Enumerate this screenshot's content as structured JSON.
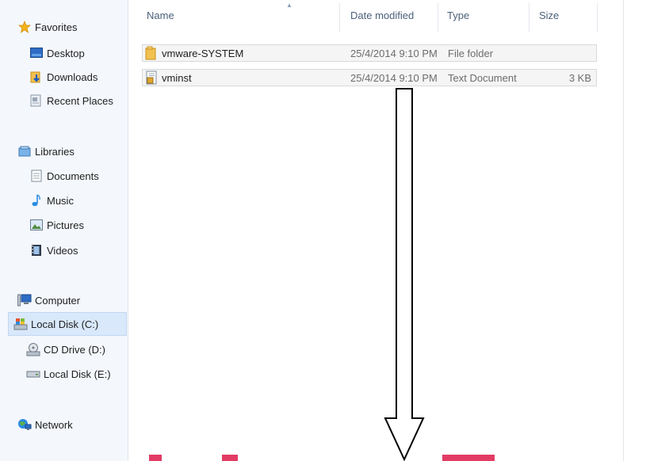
{
  "nav": {
    "favorites": "Favorites",
    "desktop": "Desktop",
    "downloads": "Downloads",
    "recent_places": "Recent Places",
    "libraries": "Libraries",
    "documents": "Documents",
    "music": "Music",
    "pictures": "Pictures",
    "videos": "Videos",
    "computer": "Computer",
    "local_disk_c": "Local Disk (C:)",
    "cd_drive_d": "CD Drive (D:)",
    "local_disk_e": "Local Disk (E:)",
    "network": "Network"
  },
  "columns": {
    "name": "Name",
    "date_modified": "Date modified",
    "type": "Type",
    "size": "Size"
  },
  "files": [
    {
      "name": "vmware-SYSTEM",
      "date": "25/4/2014 9:10 PM",
      "type": "File folder",
      "size": ""
    },
    {
      "name": "vminst",
      "date": "25/4/2014 9:10 PM",
      "type": "Text Document",
      "size": "3 KB"
    }
  ],
  "colors": {
    "nav_bg": "#f4f7fc",
    "selected_bg": "#d9e8fb",
    "row_bg": "#f5f5f5",
    "header_text": "#4c607a"
  }
}
